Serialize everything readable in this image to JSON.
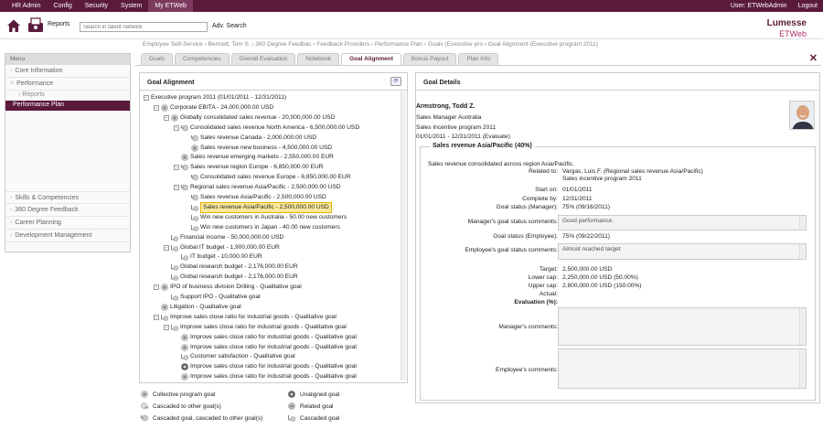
{
  "topnav": {
    "items": [
      "HR Admin",
      "Config",
      "Security",
      "System",
      "My ETWeb"
    ],
    "user": "User: ETWebAdmin",
    "logout": "Logout"
  },
  "toolbar": {
    "reports": "Reports",
    "search_placeholder": "Search in talent network",
    "adv": "Adv. Search",
    "logo_top": "Lumesse",
    "logo_bottom": "ETWeb"
  },
  "breadcrumb": "Employee Self-Service  ›  Bennett, Tom S.  ›  360 Degree Feedbac  ›  Feedback Providers  ›  Performance Plan  ›  Goals (Executive pro  ›  Goal Alignment (Executive program 2011)",
  "leftmenu": {
    "head": "Menu",
    "items": [
      "Core Information",
      "Performance"
    ],
    "sub": "Reports",
    "active": "Performance Plan",
    "bottom": [
      "Skills & Competencies",
      "360 Degree Feedback",
      "Career Planning",
      "Development Management"
    ]
  },
  "tabs": [
    "Goals",
    "Competencies",
    "Overall Evaluation",
    "Notebook",
    "Goal Alignment",
    "Bonus Payout",
    "Plan Info"
  ],
  "goalpanel": {
    "title": "Goal Alignment"
  },
  "tree": [
    {
      "t": "Executive program 2011 (01/01/2011 - 12/31/2011)",
      "d": 0,
      "tog": "-",
      "ic": "none"
    },
    {
      "t": "Corporate EBITA - 24,000,000.00 USD",
      "d": 1,
      "tog": "-",
      "ic": "collective"
    },
    {
      "t": "Globally consolidated sales revenue - 20,000,000.00 USD",
      "d": 2,
      "tog": "-",
      "ic": "collective"
    },
    {
      "t": "Consolidated sales revenue North America - 6,500,000.00 USD",
      "d": 3,
      "tog": "-",
      "ic": "cascboth"
    },
    {
      "t": "Sales revenue Canada - 2,000,000.00 USD",
      "d": 4,
      "tog": "",
      "ic": "cascboth"
    },
    {
      "t": "Sales revenue new business - 4,500,000.00 USD",
      "d": 4,
      "tog": "",
      "ic": "collective"
    },
    {
      "t": "Sales revenue emerging markets - 2,550,000.00 EUR",
      "d": 3,
      "tog": "",
      "ic": "collective"
    },
    {
      "t": "Sales revenue region Europe - 6,850,000.00 EUR",
      "d": 3,
      "tog": "-",
      "ic": "cascboth"
    },
    {
      "t": "Consolidated sales revenue Europe - 6,850,000.00 EUR",
      "d": 4,
      "tog": "",
      "ic": "cascboth"
    },
    {
      "t": "Regional sales revenue Asia/Pacific - 2,500,000.00 USD",
      "d": 3,
      "tog": "-",
      "ic": "cascboth"
    },
    {
      "t": "Sales revenue Asia/Pacific - 2,500,000.00 USD",
      "d": 4,
      "tog": "",
      "ic": "cascboth"
    },
    {
      "t": "Sales revenue Asia/Pacific - 2,500,000.00 USD",
      "d": 4,
      "tog": "",
      "ic": "cascaded",
      "sel": true
    },
    {
      "t": "Win new customers in Australia - 50.00 new customers",
      "d": 4,
      "tog": "",
      "ic": "cascaded"
    },
    {
      "t": "Win new customers in Japan - 40.00 new customers",
      "d": 4,
      "tog": "",
      "ic": "cascaded"
    },
    {
      "t": "Financial income - 50,000,000.00 USD",
      "d": 2,
      "tog": "",
      "ic": "cascaded"
    },
    {
      "t": "Global IT budget - 1,900,000.00 EUR",
      "d": 2,
      "tog": "-",
      "ic": "cascaded"
    },
    {
      "t": "IT budget - 10,000.00 EUR",
      "d": 3,
      "tog": "",
      "ic": "cascaded"
    },
    {
      "t": "Global research budget - 2,176,000.00 EUR",
      "d": 2,
      "tog": "",
      "ic": "cascaded"
    },
    {
      "t": "Global research budget - 2,176,000.00 EUR",
      "d": 2,
      "tog": "",
      "ic": "cascaded"
    },
    {
      "t": "IPO of business division Drilling - Qualitative goal",
      "d": 1,
      "tog": "-",
      "ic": "collective"
    },
    {
      "t": "Support IPO - Qualitative goal",
      "d": 2,
      "tog": "",
      "ic": "cascaded"
    },
    {
      "t": "Litigation - Qualitative goal",
      "d": 1,
      "tog": "",
      "ic": "collective"
    },
    {
      "t": "Improve sales close ratio for industrial goods - Qualitative goal",
      "d": 1,
      "tog": "-",
      "ic": "cascaded"
    },
    {
      "t": "Improve sales close ratio for industrial goods - Qualitative goal",
      "d": 2,
      "tog": "-",
      "ic": "cascaded"
    },
    {
      "t": "Improve sales close ratio for industrial goods - Qualitative goal",
      "d": 3,
      "tog": "",
      "ic": "collective"
    },
    {
      "t": "Improve sales close ratio for industrial goods - Qualitative goal",
      "d": 3,
      "tog": "",
      "ic": "collective"
    },
    {
      "t": "Customer satisfaction - Qualitative goal",
      "d": 3,
      "tog": "",
      "ic": "cascaded"
    },
    {
      "t": "Improve sales close ratio for industrial goods - Qualitative goal",
      "d": 3,
      "tog": "",
      "ic": "unaligned"
    },
    {
      "t": "Improve sales close ratio for industrial goods - Qualitative goal",
      "d": 3,
      "tog": "",
      "ic": "collective"
    }
  ],
  "legend": {
    "collective": "Collective program goal",
    "cascaded_to": "Cascaded to other goal(s)",
    "cascboth": "Cascaded goal, cascaded to other goal(s)",
    "unaligned": "Unaligned goal",
    "related": "Related goal",
    "cascaded": "Cascaded goal"
  },
  "details": {
    "title": "Goal Details",
    "name": "Armstrong, Todd Z.",
    "position": "Sales Manager Australia",
    "program": "Sales Incentive program 2011",
    "period": "01/01/2011 - 12/31/2011 (Evaluate)",
    "goal_legend": "Sales revenue Asia/Pacific (40%)",
    "desc": "Sales revenue consolidated across region Asia/Pacific.",
    "related_label": "Related to:",
    "related_val1": "Vargas, Luis F. (Regional sales revenue Asia/Pacific)",
    "related_val2": "Sales incentive program 2011",
    "start_label": "Start on:",
    "start_val": "01/01/2011",
    "complete_label": "Complete by:",
    "complete_val": "12/31/2011",
    "gsm_label": "Goal status (Manager):",
    "gsm_val": "75% (09/16/2011)",
    "mgsc_label": "Manager's goal status comments:",
    "mgsc_val": "Good performance.",
    "gse_label": "Goal status (Employee):",
    "gse_val": "75% (09/22/2011)",
    "egsc_label": "Employee's goal status comments:",
    "egsc_val": "Almost reached target",
    "target_label": "Target:",
    "target_val": "2,500,000.00 USD",
    "lower_label": "Lower cap:",
    "lower_val": "2,250,000.00 USD  (50.00%)",
    "upper_label": "Upper cap:",
    "upper_val": "2,800,000.00 USD  (150.00%)",
    "actual_label": "Actual:",
    "eval_label": "Evaluation (%):",
    "mc_label": "Manager's comments:",
    "ec_label": "Employee's comments:"
  }
}
